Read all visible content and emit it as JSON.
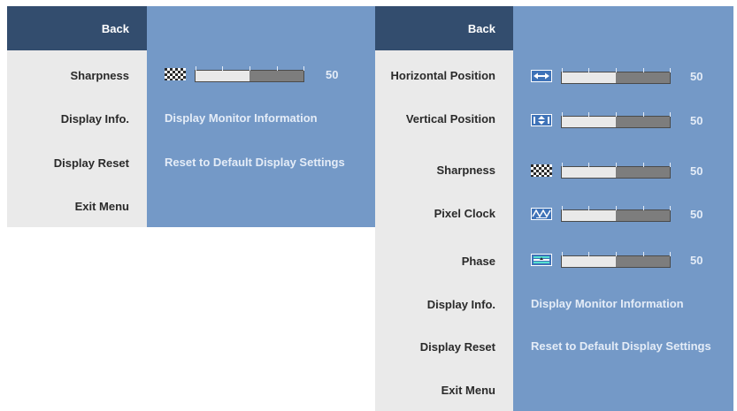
{
  "menu_a": {
    "back_label": "Back",
    "items": [
      {
        "label": "Sharpness",
        "kind": "slider",
        "icon": "sharpness-icon",
        "value": "50",
        "level": 0.5
      },
      {
        "label": "Display Info.",
        "kind": "text",
        "text": "Display Monitor Information"
      },
      {
        "label": "Display Reset",
        "kind": "text",
        "text": "Reset to Default Display Settings"
      },
      {
        "label": "Exit Menu",
        "kind": "none"
      }
    ]
  },
  "menu_b": {
    "back_label": "Back",
    "items": [
      {
        "label": "Horizontal Position",
        "kind": "slider",
        "icon": "horizontal-position-icon",
        "value": "50",
        "level": 0.5
      },
      {
        "label": "Vertical Position",
        "kind": "slider",
        "icon": "vertical-position-icon",
        "value": "50",
        "level": 0.5
      },
      {
        "label": "Sharpness",
        "kind": "slider",
        "icon": "sharpness-icon",
        "value": "50",
        "level": 0.5
      },
      {
        "label": "Pixel Clock",
        "kind": "slider",
        "icon": "pixel-clock-icon",
        "value": "50",
        "level": 0.5
      },
      {
        "label": "Phase",
        "kind": "slider",
        "icon": "phase-icon",
        "value": "50",
        "level": 0.5
      },
      {
        "label": "Display Info.",
        "kind": "text",
        "text": "Display Monitor Information"
      },
      {
        "label": "Display Reset",
        "kind": "text",
        "text": "Reset to Default Display Settings"
      },
      {
        "label": "Exit Menu",
        "kind": "none"
      }
    ]
  },
  "colors": {
    "panel_blue": "#7499c7",
    "back_navy": "#334d6e",
    "menu_gray": "#eaeaea",
    "value_text": "#e4ecf7"
  }
}
